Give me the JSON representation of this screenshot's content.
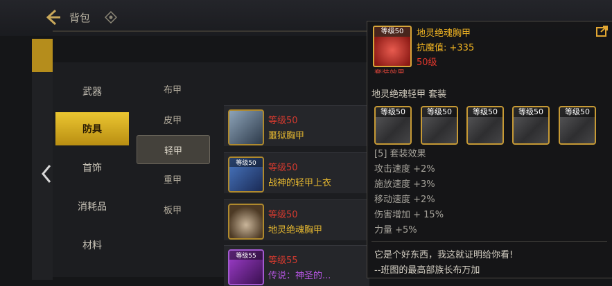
{
  "header": {
    "title": "背包",
    "right_text": ""
  },
  "categories": [
    {
      "label": "武器",
      "active": false
    },
    {
      "label": "防具",
      "active": true
    },
    {
      "label": "首饰",
      "active": false
    },
    {
      "label": "消耗品",
      "active": false
    },
    {
      "label": "材料",
      "active": false
    }
  ],
  "subcategories": [
    {
      "label": "布甲",
      "active": false
    },
    {
      "label": "皮甲",
      "active": false
    },
    {
      "label": "轻甲",
      "active": true
    },
    {
      "label": "重甲",
      "active": false
    },
    {
      "label": "板甲",
      "active": false
    }
  ],
  "items": [
    {
      "level": "等级50",
      "name": "噩狱胸甲",
      "icon_label": "",
      "name_color": "gold"
    },
    {
      "level": "等级50",
      "name": "战神的轻甲上衣",
      "icon_label": "等级50",
      "name_color": "gold"
    },
    {
      "level": "等级50",
      "name": "地灵绝魂胸甲",
      "icon_label": "",
      "name_color": "gold"
    },
    {
      "level": "等级55",
      "name": "传说：神圣的...",
      "icon_label": "等级55",
      "name_color": "purple"
    }
  ],
  "tooltip": {
    "icon_label": "等级50",
    "name": "地灵绝魂胸甲",
    "stat": "抗魔值: +335",
    "level": "50级",
    "cut_text": "套装效果",
    "set_name": "地灵绝魂轻甲 套装",
    "pieces": [
      "等级50",
      "等级50",
      "等级50",
      "等级50",
      "等级50"
    ],
    "effects": [
      "[5] 套装效果",
      "攻击速度 +2%",
      "施放速度 +3%",
      "移动速度 +2%",
      "伤害增加 + 15%",
      "力量 +5%"
    ],
    "quote_line1": "它是个好东西，我这就证明给你看!",
    "quote_line2": "--班图的最高部族长布万加"
  }
}
